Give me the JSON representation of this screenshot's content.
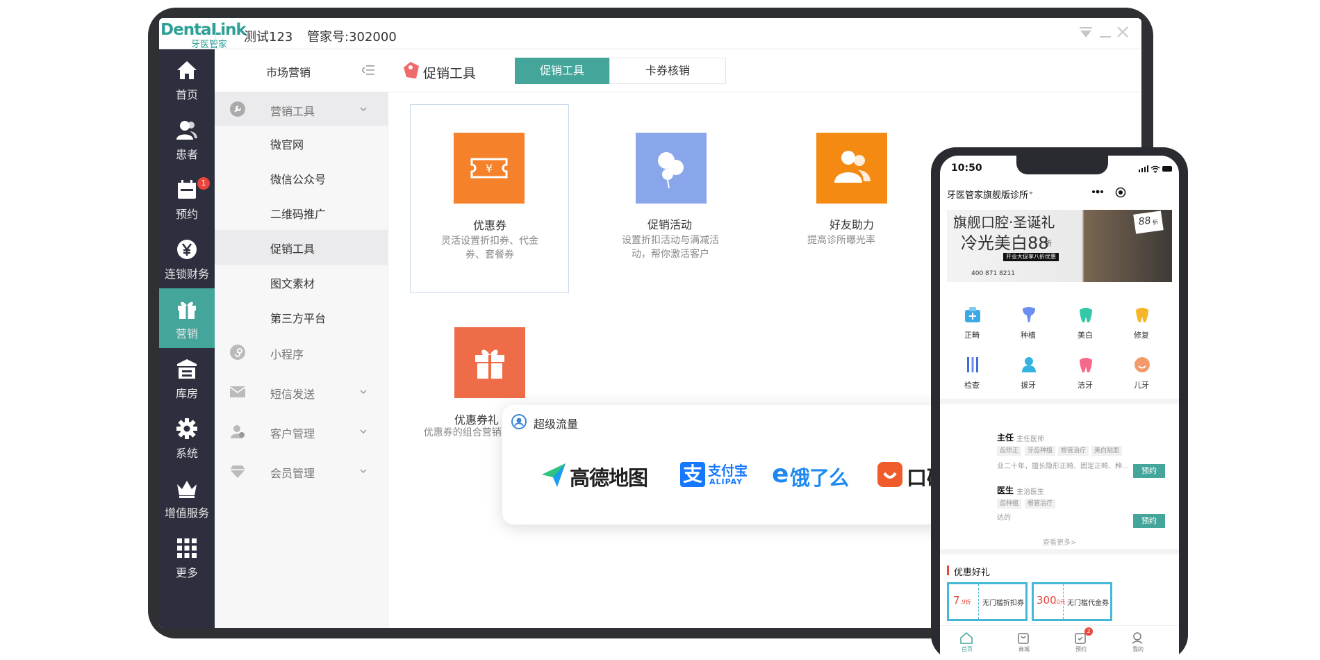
{
  "app": {
    "logo_main": "DentaLink",
    "logo_sub": "牙医管家",
    "account": "测试123",
    "manager_id": "管家号:302000"
  },
  "leftnav": [
    {
      "label": "首页",
      "icon": "home-icon"
    },
    {
      "label": "患者",
      "icon": "patients-icon"
    },
    {
      "label": "预约",
      "icon": "calendar-icon",
      "badge": "1"
    },
    {
      "label": "连锁财务",
      "icon": "yen-icon"
    },
    {
      "label": "营销",
      "icon": "gift-icon",
      "active": true
    },
    {
      "label": "库房",
      "icon": "warehouse-icon"
    },
    {
      "label": "系统",
      "icon": "gear-icon"
    },
    {
      "label": "增值服务",
      "icon": "crown-icon"
    },
    {
      "label": "更多",
      "icon": "grid-icon"
    }
  ],
  "submenu": {
    "title": "市场营销",
    "groups": [
      {
        "label": "营销工具",
        "expanded": true
      },
      {
        "label": "小程序"
      },
      {
        "label": "短信发送"
      },
      {
        "label": "客户管理"
      },
      {
        "label": "会员管理"
      }
    ],
    "subitems": [
      "微官网",
      "微信公众号",
      "二维码推广",
      "促销工具",
      "图文素材",
      "第三方平台"
    ]
  },
  "main": {
    "title": "促销工具",
    "tabs": [
      {
        "label": "促销工具",
        "active": true
      },
      {
        "label": "卡券核销"
      }
    ],
    "tiles": [
      {
        "name": "优惠券",
        "desc_l1": "灵活设置折扣券、代金",
        "desc_l2": "券、套餐券",
        "color": "#f5812b"
      },
      {
        "name": "促销活动",
        "desc_l1": "设置折扣活动与满减活",
        "desc_l2": "动，帮你激活客户",
        "color": "#8aa6ea"
      },
      {
        "name": "好友助力",
        "desc_l1": "提高诊所曝光率",
        "desc_l2": "",
        "color": "#f58a13"
      },
      {
        "name": "优惠券礼",
        "desc_l1": "优惠券的组合营销,一",
        "desc_l2": "",
        "color": "#ee6c48"
      }
    ]
  },
  "traffic": {
    "title": "超级流量",
    "partners": [
      {
        "name": "高德地图",
        "color": "#1a75e8"
      },
      {
        "name": "支付宝",
        "sub": "ALIPAY",
        "color": "#1678ff"
      },
      {
        "name": "饿了么",
        "color": "#1e89f0"
      },
      {
        "name": "口碑",
        "color": "#ef5b2b"
      }
    ]
  },
  "phone": {
    "time": "10:50",
    "clinic": "牙医管家旗舰版诊所",
    "banner": {
      "line1": "旗舰口腔·圣诞礼",
      "line2": "冷光美白88",
      "line2_suffix": "折",
      "badge": "88",
      "badge_suffix": "折",
      "ribbon": "开业大促享八折优惠",
      "phone": "400 871 8211"
    },
    "categories": [
      {
        "label": "正畸",
        "color": "#3ba9e6"
      },
      {
        "label": "种植",
        "color": "#6b8ff0"
      },
      {
        "label": "美白",
        "color": "#34c7a8"
      },
      {
        "label": "修复",
        "color": "#f6b62a"
      },
      {
        "label": "检查",
        "color": "#3d6bd8"
      },
      {
        "label": "拔牙",
        "color": "#35b3e0"
      },
      {
        "label": "洁牙",
        "color": "#f56a8a"
      },
      {
        "label": "儿牙",
        "color": "#f29a6a"
      }
    ],
    "doctors": [
      {
        "name": "主任",
        "title": "主任医师",
        "tags": [
          "齿矫正",
          "牙齿种植",
          "根管治疗",
          "美白贴面"
        ],
        "desc": "业二十年，擅长隐形正畸、固定正畸、种…",
        "button": "预约"
      },
      {
        "name": "医生",
        "title": "主治医生",
        "tags": [
          "齿种植",
          "根管治疗"
        ],
        "desc": "达的",
        "button": "预约"
      }
    ],
    "more": "查看更多>",
    "coupons_title": "优惠好礼",
    "coupons": [
      {
        "value": "7",
        "unit": ".9折",
        "name": "无门槛折扣券"
      },
      {
        "value": "300",
        "unit": ".0元",
        "name": "无门槛代金券"
      }
    ],
    "bottom_nav": [
      {
        "label": "首页",
        "active": true
      },
      {
        "label": "商城"
      },
      {
        "label": "预约",
        "badge": "2"
      },
      {
        "label": "我的"
      }
    ]
  }
}
